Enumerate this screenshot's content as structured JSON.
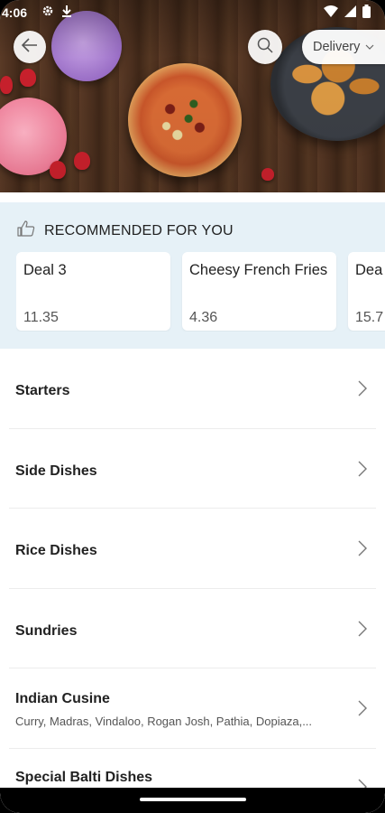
{
  "status_bar": {
    "time": "4:06"
  },
  "header": {
    "delivery_label": "Delivery"
  },
  "recommended": {
    "title": "RECOMMENDED FOR YOU",
    "items": [
      {
        "name": "Deal 3",
        "price": "11.35"
      },
      {
        "name": "Cheesy French Fries",
        "price": "4.36"
      },
      {
        "name": "Dea",
        "price": "15.7"
      }
    ]
  },
  "categories": [
    {
      "name": "Starters",
      "subtitle": ""
    },
    {
      "name": "Side Dishes",
      "subtitle": ""
    },
    {
      "name": "Rice Dishes",
      "subtitle": ""
    },
    {
      "name": "Sundries",
      "subtitle": ""
    },
    {
      "name": "Indian Cusine",
      "subtitle": "Curry, Madras, Vindaloo, Rogan Josh, Pathia, Dopiaza,..."
    },
    {
      "name": "Special Balti Dishes",
      "subtitle": ""
    }
  ],
  "colors": {
    "recommended_bg": "#e6f1f7",
    "text_dark": "#222222"
  }
}
